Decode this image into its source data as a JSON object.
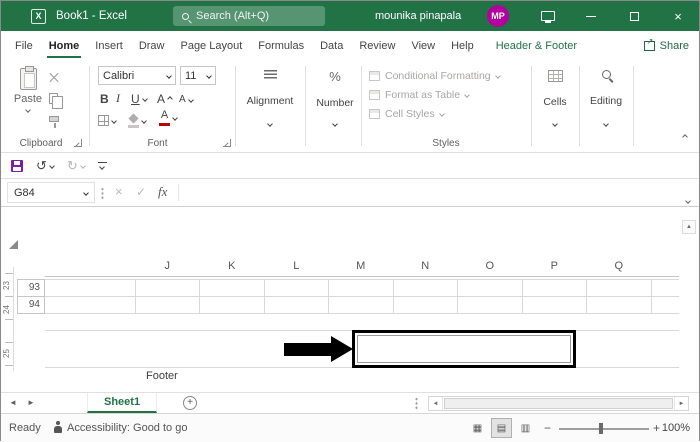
{
  "colors": {
    "accent": "#217346",
    "avatar": "#b4009e",
    "annotation": "#000000",
    "font_color_red": "#c00000"
  },
  "titlebar": {
    "app_icon_letter": "X",
    "app_title": "Book1 - Excel",
    "search_placeholder": "Search (Alt+Q)",
    "user_name": "mounika pinapala",
    "user_initials": "MP"
  },
  "tabs": {
    "items": [
      "File",
      "Home",
      "Insert",
      "Draw",
      "Page Layout",
      "Formulas",
      "Data",
      "Review",
      "View",
      "Help"
    ],
    "contextual": "Header & Footer",
    "share_label": "Share"
  },
  "ribbon": {
    "paste_label": "Paste",
    "font_name": "Calibri",
    "font_size": "11",
    "bold_label": "B",
    "italic_label": "I",
    "underline_label": "U",
    "grow_font_label": "A",
    "shrink_font_label": "A",
    "font_color_label": "A",
    "number_symbol": "%",
    "styles_items": [
      "Conditional Formatting",
      "Format as Table",
      "Cell Styles"
    ],
    "group_labels": {
      "clipboard": "Clipboard",
      "font": "Font",
      "styles": "Styles"
    },
    "collapsed_groups": {
      "alignment": "Alignment",
      "number": "Number",
      "cells": "Cells",
      "editing": "Editing"
    }
  },
  "formula_bar": {
    "name_box": "G84",
    "fx_label": "fx",
    "value": ""
  },
  "sheet": {
    "columns": [
      "J",
      "K",
      "L",
      "M",
      "N",
      "O",
      "P",
      "Q"
    ],
    "row_numbers": [
      "93",
      "94"
    ],
    "ruler_marks": [
      "23",
      "24",
      "25"
    ],
    "footer_label": "Footer"
  },
  "sheet_tabs": {
    "active_sheet": "Sheet1",
    "add_label": "+"
  },
  "status": {
    "mode": "Ready",
    "accessibility_text": "Accessibility: Good to go",
    "zoom_level": "100%"
  },
  "icons": {
    "close": "×",
    "undo": "↺",
    "redo": "↻",
    "scroll_up": "▲",
    "tab_prev": "◄",
    "tab_next": "►",
    "hscroll_left": "◄",
    "hscroll_right": "►",
    "view_normal": "▦",
    "view_page_layout": "▤",
    "view_page_break": "▥",
    "zoom_out": "−",
    "zoom_in": "+",
    "cancel": "×",
    "enter": "✓",
    "share_arrow": "↗"
  }
}
